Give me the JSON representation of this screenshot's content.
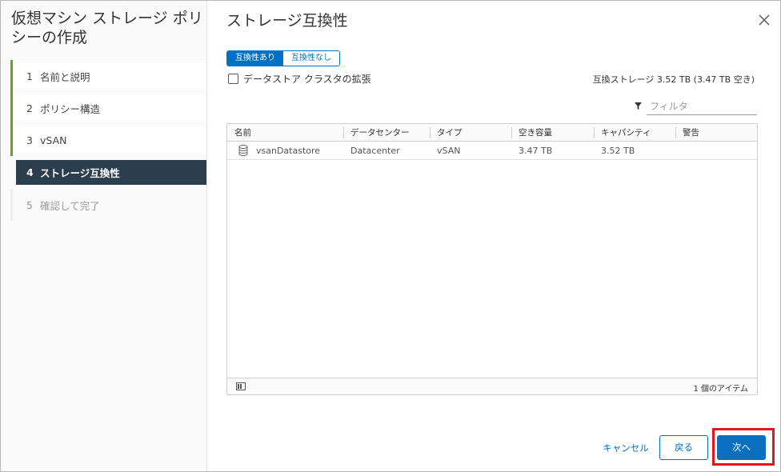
{
  "wizard": {
    "title": "仮想マシン ストレージ ポリシーの作成",
    "steps": [
      {
        "num": "1",
        "label": "名前と説明"
      },
      {
        "num": "2",
        "label": "ポリシー構造"
      },
      {
        "num": "3",
        "label": "vSAN"
      },
      {
        "num": "4",
        "label": "ストレージ互換性"
      },
      {
        "num": "5",
        "label": "確認して完了"
      }
    ]
  },
  "main": {
    "title": "ストレージ互換性",
    "toggle": {
      "compatible": "互換性あり",
      "incompatible": "互換性なし"
    },
    "checkbox_label": "データストア クラスタの拡張",
    "compat_storage": "互換ストレージ 3.52 TB (3.47 TB 空き)",
    "filter_placeholder": "フィルタ"
  },
  "grid": {
    "columns": [
      "名前",
      "データセンター",
      "タイプ",
      "空き容量",
      "キャパシティ",
      "警告"
    ],
    "rows": [
      {
        "name": "vsanDatastore",
        "datacenter": "Datacenter",
        "type": "vSAN",
        "free": "3.47 TB",
        "capacity": "3.52 TB",
        "warning": ""
      }
    ],
    "item_count": "1 個のアイテム"
  },
  "footer": {
    "cancel": "キャンセル",
    "back": "戻る",
    "next": "次へ"
  },
  "colors": {
    "accent": "#0072c6",
    "active_step": "#2b3e4e",
    "done_step": "#62a420",
    "highlight": "#e8141b"
  }
}
